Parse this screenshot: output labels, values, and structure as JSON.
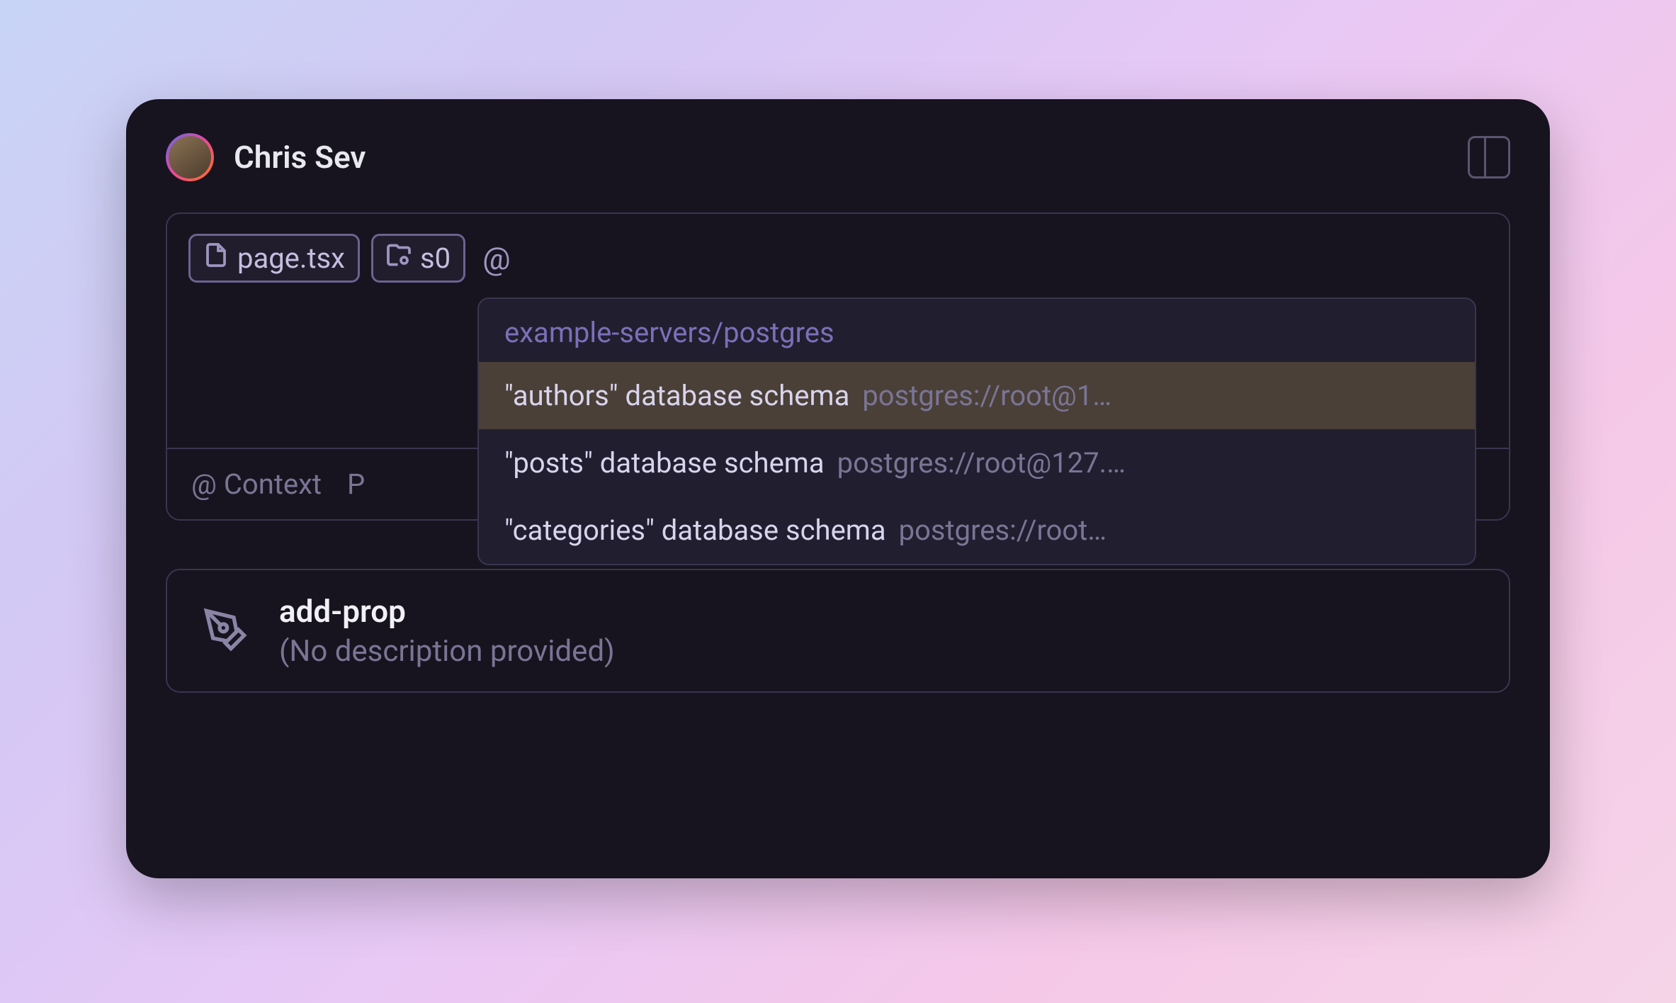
{
  "header": {
    "username": "Chris Sev"
  },
  "input": {
    "chips": [
      {
        "icon": "file",
        "label": "page.tsx"
      },
      {
        "icon": "folder",
        "label": "s0"
      }
    ],
    "trailing": "@",
    "context_label": "@ Context",
    "partial_label": "P"
  },
  "dropdown": {
    "heading": "example-servers/postgres",
    "items": [
      {
        "title": "\"authors\" database schema",
        "detail": "postgres://root@1…",
        "selected": true
      },
      {
        "title": "\"posts\" database schema",
        "detail": "postgres://root@127.…",
        "selected": false
      },
      {
        "title": "\"categories\" database schema",
        "detail": "postgres://root…",
        "selected": false
      }
    ]
  },
  "card": {
    "title": "add-prop",
    "description": "(No description provided)"
  }
}
